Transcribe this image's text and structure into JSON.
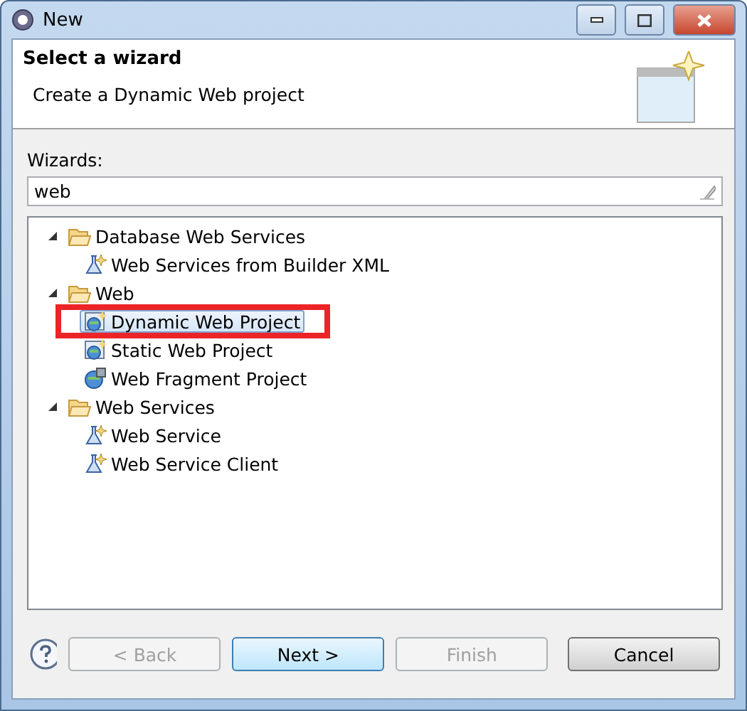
{
  "window": {
    "title": "New"
  },
  "header": {
    "title": "Select a wizard",
    "description": "Create a Dynamic Web project"
  },
  "filter": {
    "label": "Wizards:",
    "value": "web"
  },
  "tree": [
    {
      "label": "Database Web Services",
      "expanded": true,
      "children": [
        {
          "label": "Web Services from Builder XML",
          "kind": "service",
          "selected": false
        }
      ]
    },
    {
      "label": "Web",
      "expanded": true,
      "children": [
        {
          "label": "Dynamic Web Project",
          "kind": "project",
          "selected": true
        },
        {
          "label": "Static Web Project",
          "kind": "project",
          "selected": false
        },
        {
          "label": "Web Fragment Project",
          "kind": "fragment",
          "selected": false
        }
      ]
    },
    {
      "label": "Web Services",
      "expanded": true,
      "children": [
        {
          "label": "Web Service",
          "kind": "service",
          "selected": false
        },
        {
          "label": "Web Service Client",
          "kind": "service",
          "selected": false
        }
      ]
    }
  ],
  "buttons": [
    {
      "label": "< Back",
      "disabled": true,
      "default": false
    },
    {
      "label": "Next >",
      "disabled": false,
      "default": true
    },
    {
      "label": "Finish",
      "disabled": true,
      "default": false
    },
    {
      "label": "Cancel",
      "disabled": false,
      "default": false
    }
  ]
}
